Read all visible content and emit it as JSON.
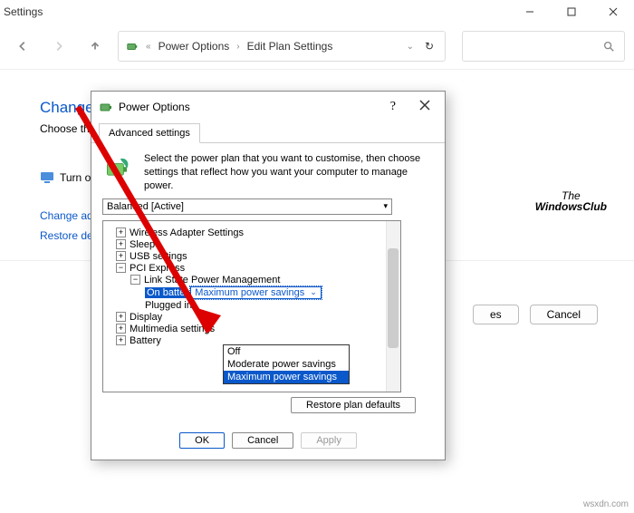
{
  "bg": {
    "title": "Settings",
    "breadcrumb": {
      "a": "Power Options",
      "b": "Edit Plan Settings"
    },
    "heading": "Change se",
    "sub": "Choose the s",
    "turn_off": "Turn off",
    "link1": "Change adva",
    "link2": "Restore defa",
    "btn_changes": "es",
    "btn_cancel": "Cancel"
  },
  "dlg": {
    "title": "Power Options",
    "tab": "Advanced settings",
    "intro": "Select the power plan that you want to customise, then choose settings that reflect how you want your computer to manage power.",
    "watermark1": "The",
    "watermark2": "WindowsClub",
    "plan": "Balanced [Active]",
    "tree": {
      "wireless": "Wireless Adapter Settings",
      "sleep": "Sleep",
      "usb": "USB settings",
      "pci": "PCI Express",
      "linkstate": "Link State Power Management",
      "onbatt_label": "On batte",
      "onbatt_value": "Maximum power savings",
      "plugged": "Plugged in:",
      "display": "Display",
      "multimedia": "Multimedia settings",
      "battery": "Battery"
    },
    "dd": {
      "off": "Off",
      "mod": "Moderate power savings",
      "max": "Maximum power savings"
    },
    "restore": "Restore plan defaults",
    "ok": "OK",
    "cancel": "Cancel",
    "apply": "Apply"
  },
  "credit": "wsxdn.com"
}
